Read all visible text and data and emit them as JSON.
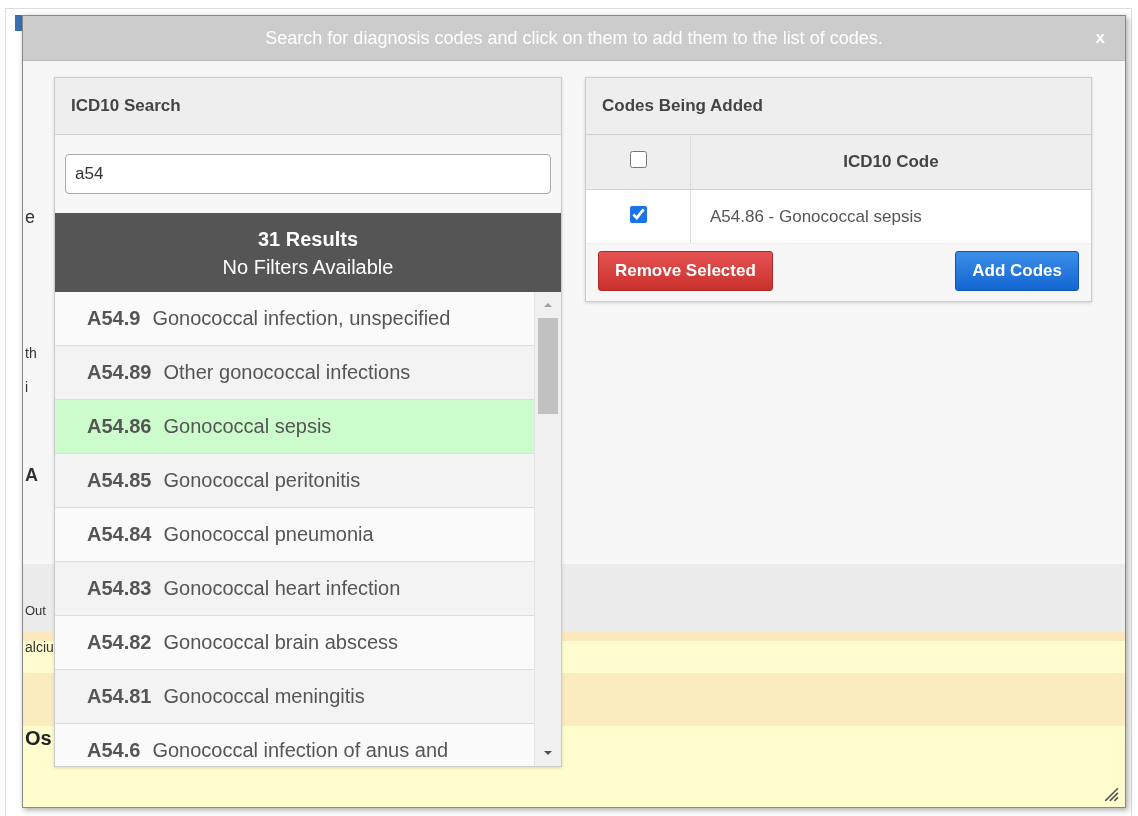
{
  "background_fragments": [
    "e",
    "th",
    "i",
    "A",
    "Out",
    "alciu",
    "Os"
  ],
  "dialog": {
    "title": "Search for diagnosis codes and click on them to add them to the list of codes.",
    "close": "x"
  },
  "search_panel": {
    "title": "ICD10 Search",
    "query": "a54",
    "results_count": "31 Results",
    "filters_note": "No Filters Available",
    "results": [
      {
        "code": "A54.9",
        "description": "Gonococcal infection, unspecified",
        "selected": false
      },
      {
        "code": "A54.89",
        "description": "Other gonococcal infections",
        "selected": false
      },
      {
        "code": "A54.86",
        "description": "Gonococcal sepsis",
        "selected": true
      },
      {
        "code": "A54.85",
        "description": "Gonococcal peritonitis",
        "selected": false
      },
      {
        "code": "A54.84",
        "description": "Gonococcal pneumonia",
        "selected": false
      },
      {
        "code": "A54.83",
        "description": "Gonococcal heart infection",
        "selected": false
      },
      {
        "code": "A54.82",
        "description": "Gonococcal brain abscess",
        "selected": false
      },
      {
        "code": "A54.81",
        "description": "Gonococcal meningitis",
        "selected": false
      },
      {
        "code": "A54.6",
        "description": "Gonococcal infection of anus and",
        "selected": false
      }
    ]
  },
  "codes_panel": {
    "title": "Codes Being Added",
    "header_checked": false,
    "column": "ICD10 Code",
    "rows": [
      {
        "checked": true,
        "text": "A54.86 - Gonococcal sepsis"
      }
    ],
    "buttons": [
      {
        "label": "Remove Selected",
        "kind": "danger"
      },
      {
        "label": "Add Codes",
        "kind": "primary"
      }
    ]
  }
}
